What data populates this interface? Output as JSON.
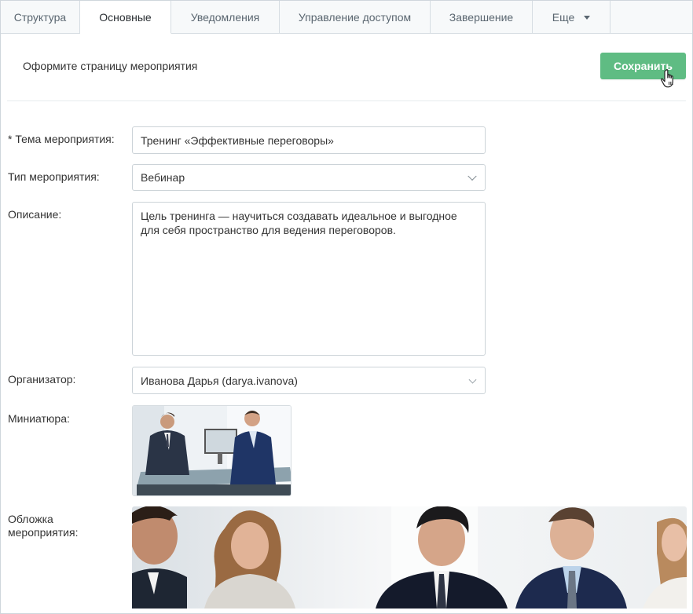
{
  "tabs": [
    {
      "label": "Структура",
      "active": false
    },
    {
      "label": "Основные",
      "active": true
    },
    {
      "label": "Уведомления",
      "active": false
    },
    {
      "label": "Управление доступом",
      "active": false
    },
    {
      "label": "Завершение",
      "active": false
    },
    {
      "label": "Еще",
      "active": false
    }
  ],
  "header": {
    "subtitle": "Оформите страницу мероприятия",
    "save_label": "Сохранить"
  },
  "form": {
    "topic_label": "* Тема мероприятия:",
    "topic_value": "Тренинг «Эффективные переговоры»",
    "type_label": "Тип мероприятия:",
    "type_value": "Вебинар",
    "description_label": "Описание:",
    "description_value": "Цель тренинга — научиться создавать идеальное и выгодное для себя пространство для ведения переговоров.",
    "organizer_label": "Организатор:",
    "organizer_value": "Иванова Дарья (darya.ivanova)",
    "thumbnail_label": "Миниатюра:",
    "cover_label_line1": "Обложка",
    "cover_label_line2": "мероприятия:"
  },
  "colors": {
    "accent": "#5fbc83",
    "tab_bg": "#f7f9fa",
    "border": "#ccd3d8"
  },
  "icons": {
    "dropdown": "chevron-down-icon",
    "more": "caret-down-icon",
    "cursor": "hand-pointer-icon"
  }
}
